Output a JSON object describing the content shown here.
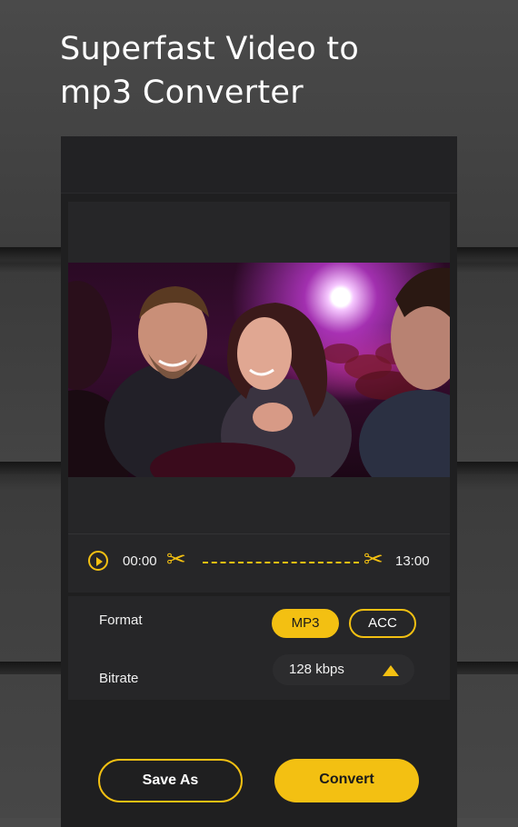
{
  "headline": {
    "line1": "Superfast Video to",
    "line2": "mp3 Converter"
  },
  "player": {
    "start_time": "00:00",
    "end_time": "13:00"
  },
  "settings": {
    "format_label": "Format",
    "format_options": [
      "MP3",
      "ACC"
    ],
    "selected_format": "MP3",
    "bitrate_label": "Bitrate",
    "bitrate_value": "128 kbps"
  },
  "actions": {
    "save_as": "Save As",
    "convert": "Convert"
  },
  "colors": {
    "accent": "#f3c012",
    "panel": "#262628",
    "background": "#1f1f20"
  }
}
